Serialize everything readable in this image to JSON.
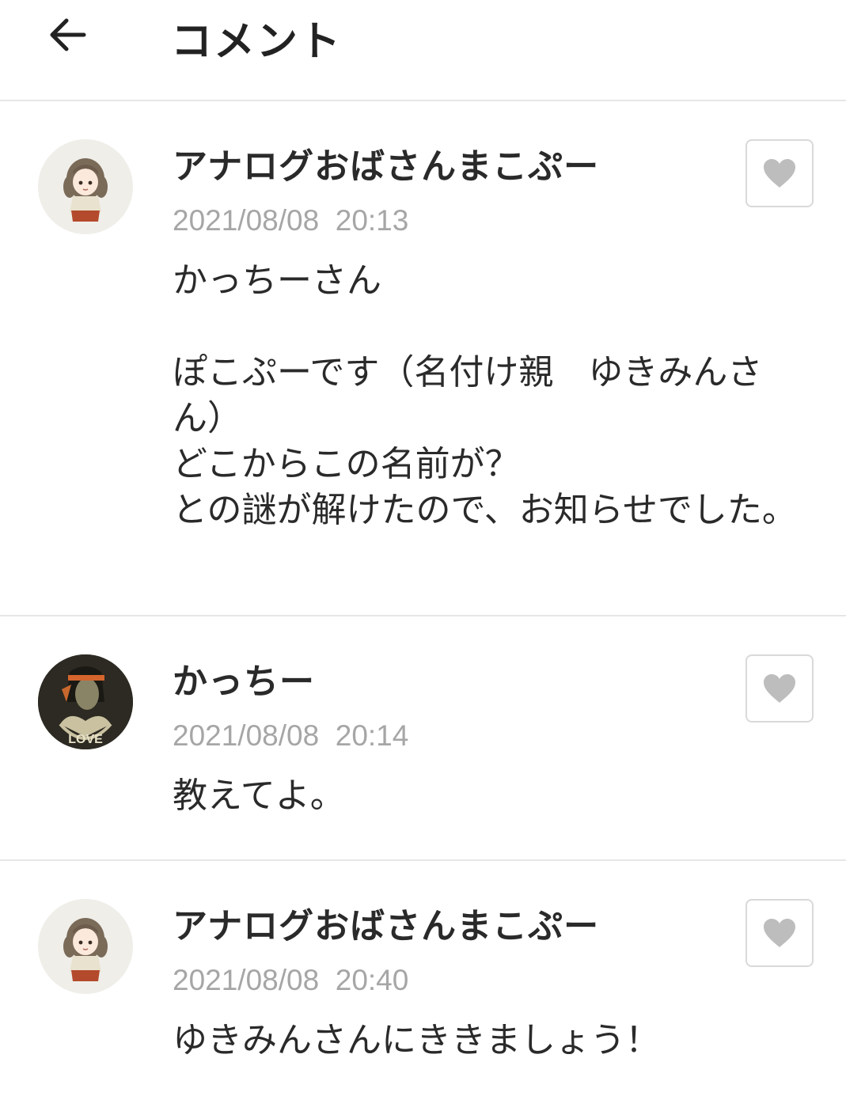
{
  "header": {
    "title": "コメント",
    "back_icon": "arrow-left-icon"
  },
  "colors": {
    "divider": "#e6e6e6",
    "timestamp": "#a6a6a6",
    "heart": "#bdbdbd",
    "text": "#2a2a2a"
  },
  "comments": [
    {
      "author": "アナログおばさんまこぷー",
      "timestamp": "2021/08/08  20:13",
      "body": "かっちーさん\n\nぽこぷーです（名付け親　ゆきみんさん）\nどこからこの名前が？\nとの謎が解けたので、お知らせでした。",
      "avatar": "girl-illustration-avatar",
      "like_icon": "heart-icon"
    },
    {
      "author": "かっちー",
      "timestamp": "2021/08/08  20:14",
      "body": "教えてよ。",
      "avatar": "love-hands-avatar",
      "avatar_text": "LOVE",
      "like_icon": "heart-icon"
    },
    {
      "author": "アナログおばさんまこぷー",
      "timestamp": "2021/08/08  20:40",
      "body": "ゆきみんさんにききましょう！",
      "avatar": "girl-illustration-avatar",
      "like_icon": "heart-icon"
    }
  ]
}
